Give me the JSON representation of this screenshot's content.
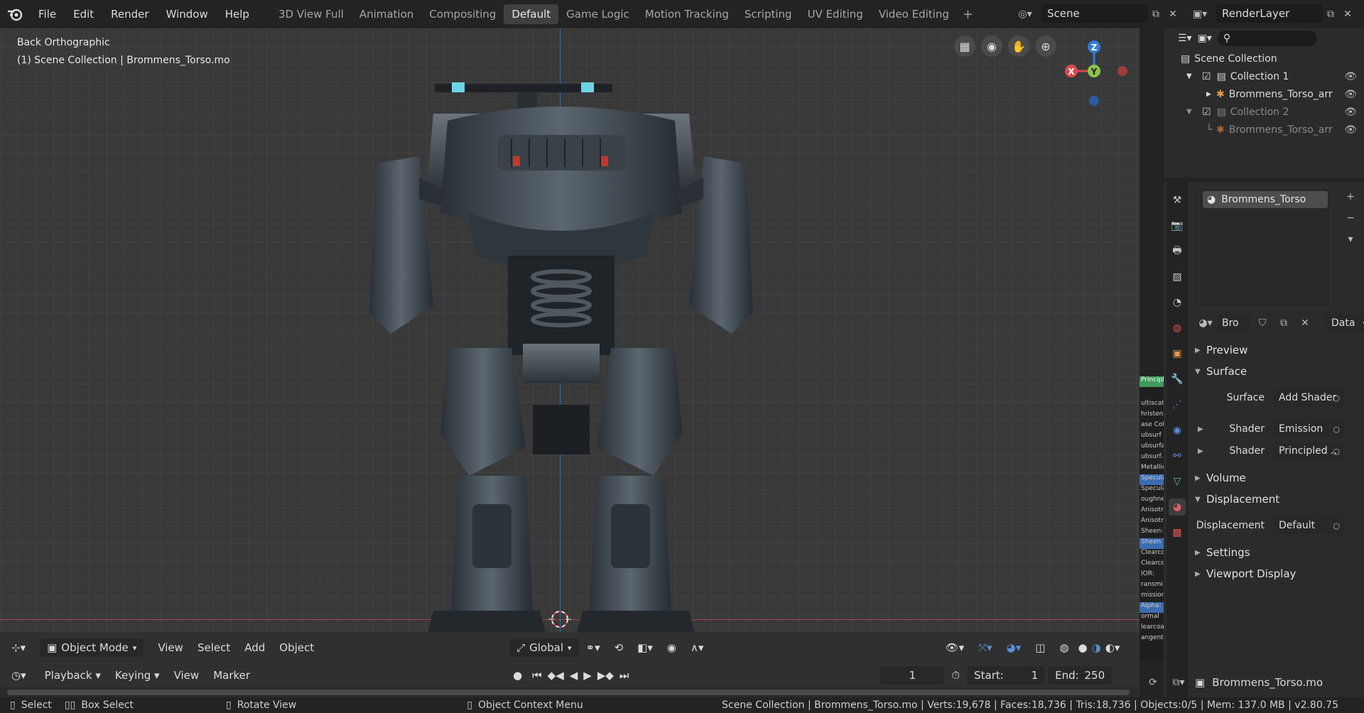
{
  "app": {
    "name": "Blender",
    "version": "v2.80.75"
  },
  "menu": [
    "File",
    "Edit",
    "Render",
    "Window",
    "Help"
  ],
  "workspaces": [
    "3D View Full",
    "Animation",
    "Compositing",
    "Default",
    "Game Logic",
    "Motion Tracking",
    "Scripting",
    "UV Editing",
    "Video Editing"
  ],
  "active_workspace": "Default",
  "scene": {
    "label": "Scene"
  },
  "render_layer": {
    "label": "RenderLayer"
  },
  "viewport": {
    "view_name": "Back Orthographic",
    "collection_info": "(1) Scene Collection | Brommens_Torso.mo",
    "gizmo": {
      "x": "X",
      "y": "Y",
      "z": "Z"
    }
  },
  "viewport_header": {
    "mode": "Object Mode",
    "view": "View",
    "select": "Select",
    "add": "Add",
    "object": "Object",
    "orientation": "Global"
  },
  "timeline": {
    "playback": "Playback",
    "keying": "Keying",
    "view": "View",
    "marker": "Marker",
    "current_frame": "1",
    "start_label": "Start:",
    "start": "1",
    "end_label": "End:",
    "end": "250"
  },
  "outliner": {
    "root": "Scene Collection",
    "items": [
      {
        "label": "Collection 1"
      },
      {
        "label": "Brommens_Torso_arr"
      },
      {
        "label": "Collection 2"
      },
      {
        "label": "Brommens_Torso_arr"
      }
    ]
  },
  "properties": {
    "material_slot": "Brommens_Torso",
    "material_short": "Bro",
    "data_dropdown": "Data",
    "sections": {
      "preview": "Preview",
      "surface": "Surface",
      "volume": "Volume",
      "displacement": "Displacement",
      "settings": "Settings",
      "viewport_display": "Viewport Display"
    },
    "rows": {
      "surface_label": "Surface",
      "surface_value": "Add Shader",
      "shader1_label": "Shader",
      "shader1_value": "Emission",
      "shader2_label": "Shader",
      "shader2_value": "Principled ..",
      "displacement_label": "Displacement",
      "displacement_value": "Default"
    },
    "object_name": "Brommens_Torso.mo"
  },
  "node_strip": [
    "Principle",
    "ultiscat",
    "hristens",
    "ase Col",
    "ubsurf",
    "ubsurfa",
    "ubsurf..",
    "Metallic",
    "Specula",
    "Specula",
    "oughne",
    "Anisotro",
    "Anisotro",
    "Sheen:",
    "Sheen T",
    "Clearco",
    "Clearco",
    "IOR:",
    "ransmi",
    "mission",
    "Alpha:",
    "ormal",
    "learcoa",
    "angent"
  ],
  "statusbar": {
    "select": "Select",
    "box_select": "Box Select",
    "rotate": "Rotate View",
    "context": "Object Context Menu",
    "stats": "Scene Collection | Brommens_Torso.mo | Verts:19,678 | Faces:18,736 | Tris:18,736 | Objects:0/5 | Mem: 137.0 MB | v2.80.75"
  },
  "colors": {
    "accent": "#4772b3",
    "x_axis": "#d94a4a",
    "y_axis": "#8bc34a",
    "z_axis": "#2f7cd6",
    "viewport_bg": "#393939"
  }
}
